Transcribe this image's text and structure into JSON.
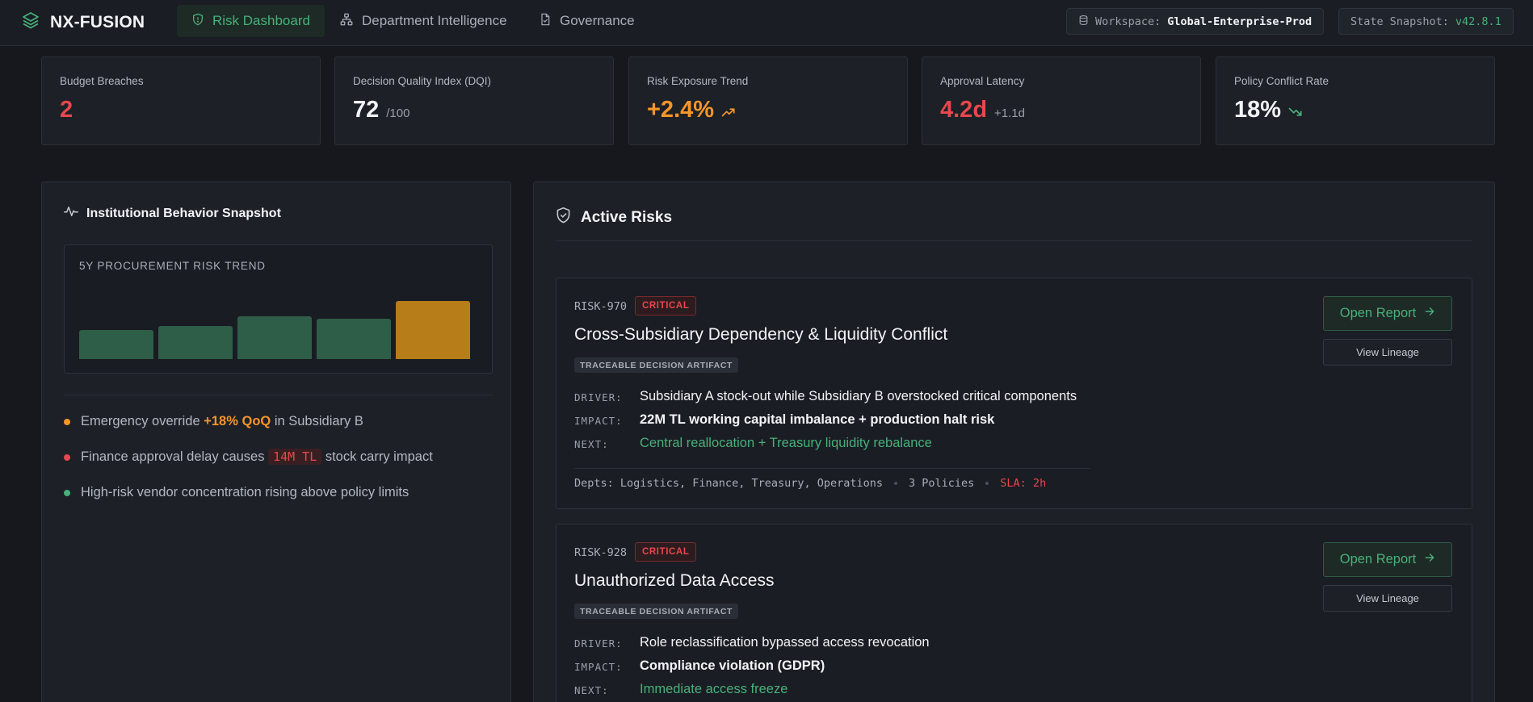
{
  "header": {
    "brand": "NX-FUSION",
    "nav": [
      {
        "label": "Risk Dashboard",
        "icon": "shield-icon",
        "active": true
      },
      {
        "label": "Department Intelligence",
        "icon": "org-chart-icon",
        "active": false
      },
      {
        "label": "Governance",
        "icon": "document-check-icon",
        "active": false
      }
    ],
    "workspace_label": "Workspace:",
    "workspace_value": "Global-Enterprise-Prod",
    "snapshot_label": "State Snapshot:",
    "snapshot_value": "v42.8.1"
  },
  "kpis": [
    {
      "label": "Budget Breaches",
      "value": "2",
      "sub": "",
      "color": "#e5484d"
    },
    {
      "label": "Decision Quality Index (DQI)",
      "value": "72",
      "sub": "/100",
      "color": "#f2f4f7"
    },
    {
      "label": "Risk Exposure Trend",
      "value": "+2.4%",
      "sub": "",
      "icon": "trend-up-icon",
      "color": "#f5962b"
    },
    {
      "label": "Approval Latency",
      "value": "4.2d",
      "sub": "+1.1d",
      "color": "#e5484d"
    },
    {
      "label": "Policy Conflict Rate",
      "value": "18%",
      "sub": "",
      "icon": "trend-down-icon",
      "color": "#f2f4f7"
    }
  ],
  "snapshot": {
    "title": "Institutional Behavior Snapshot",
    "trend_label": "5Y PROCUREMENT RISK TREND",
    "trend_bars": [
      {
        "level": 0.48,
        "color": "#2e5e47"
      },
      {
        "level": 0.54,
        "color": "#2e5e47"
      },
      {
        "level": 0.71,
        "color": "#2e5e47"
      },
      {
        "level": 0.66,
        "color": "#2e5e47"
      },
      {
        "level": 0.96,
        "color": "#b77d19"
      }
    ],
    "bullets": [
      {
        "before": "Emergency override ",
        "highlight": "+18% QoQ",
        "after": " in Subsidiary B",
        "dot": "#f5962b"
      },
      {
        "before": "Finance approval delay causes ",
        "highlight": "14M TL",
        "after": " stock carry impact",
        "dot": "#e5484d"
      },
      {
        "before": "High-risk vendor concentration rising above policy limits",
        "highlight": "",
        "after": "",
        "dot": "#48b07a"
      }
    ]
  },
  "active_risks": {
    "title": "Active Risks",
    "items": [
      {
        "id": "RISK-970",
        "severity": "CRITICAL",
        "title": "Cross-Subsidiary Dependency & Liquidity Conflict",
        "artifact": "TRACEABLE DECISION ARTIFACT",
        "driver_key": "DRIVER:",
        "driver": "Subsidiary A stock-out while Subsidiary B overstocked critical components",
        "impact_key": "IMPACT:",
        "impact": "22M TL working capital imbalance + production halt risk",
        "next_key": "NEXT:",
        "next": "Central reallocation + Treasury liquidity rebalance",
        "depts": "Depts: Logistics, Finance, Treasury, Operations",
        "policies": "3 Policies",
        "sla": "SLA: 2h",
        "open_label": "Open Report",
        "lineage_label": "View Lineage"
      },
      {
        "id": "RISK-928",
        "severity": "CRITICAL",
        "title": "Unauthorized Data Access",
        "artifact": "TRACEABLE DECISION ARTIFACT",
        "driver_key": "DRIVER:",
        "driver": "Role reclassification bypassed access revocation",
        "impact_key": "IMPACT:",
        "impact": "Compliance violation (GDPR)",
        "next_key": "NEXT:",
        "next": "Immediate access freeze",
        "open_label": "Open Report",
        "lineage_label": "View Lineage"
      }
    ]
  }
}
